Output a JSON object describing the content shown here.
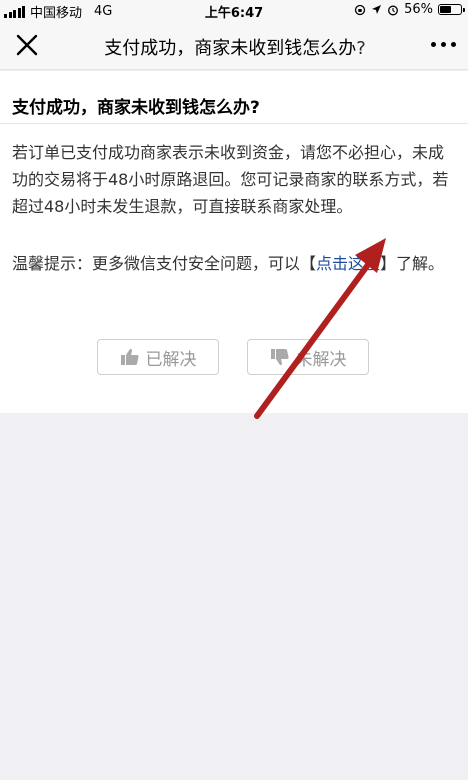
{
  "status_bar": {
    "carrier": "中国移动",
    "network": "4G",
    "time": "上午6:47",
    "battery_percent": "56%",
    "battery_level": 0.56
  },
  "nav": {
    "title": "支付成功，商家未收到钱怎么办?",
    "close_icon": "close-icon",
    "more_icon": "more-icon"
  },
  "article": {
    "title": "支付成功，商家未收到钱怎么办?",
    "body": "若订单已支付成功商家表示未收到资金，请您不必担心，未成功的交易将于48小时原路退回。您可记录商家的联系方式，若超过48小时未发生退款，可直接联系商家处理。",
    "tip_prefix": "温馨提示：更多微信支付安全问题，可以【",
    "tip_link": "点击这里",
    "tip_suffix": "】了解。"
  },
  "feedback": {
    "solved_label": "已解决",
    "unsolved_label": "未解决"
  },
  "colors": {
    "link": "#1a4d9e",
    "annotation_arrow": "#b0201e",
    "background": "#efeff4"
  }
}
